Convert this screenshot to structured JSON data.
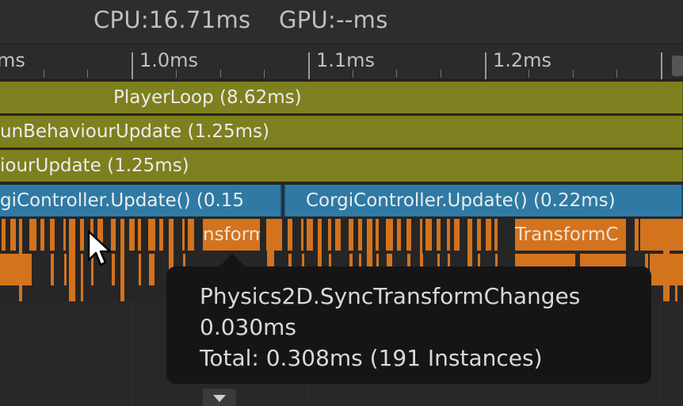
{
  "header": {
    "cpu": "CPU:16.71ms",
    "gpu": "GPU:--ms"
  },
  "ruler": {
    "partial_label": "ms",
    "labels": [
      "1.0ms",
      "1.1ms",
      "1.2ms"
    ]
  },
  "bars": {
    "player_loop": "PlayerLoop (8.62ms)",
    "run_behaviour_update": "unBehaviourUpdate (1.25ms)",
    "behaviour_update": "iourUpdate (1.25ms)",
    "corgi_left": "giController.Update() (0.15",
    "corgi_right": "CorgiController.Update() (0.22ms)"
  },
  "orange": {
    "block_left": "nsform",
    "block_right": "TransformC"
  },
  "tooltip": {
    "name": "Physics2D.SyncTransformChanges",
    "time": "0.030ms",
    "total": "Total: 0.308ms (191 Instances)"
  },
  "colors": {
    "olive": "#7e7f1e",
    "blue": "#2e7aa4",
    "orange": "#d3731e",
    "tooltip_bg": "#151515"
  },
  "icons": [
    "mouse-pointer-icon",
    "chevron-down-icon"
  ]
}
